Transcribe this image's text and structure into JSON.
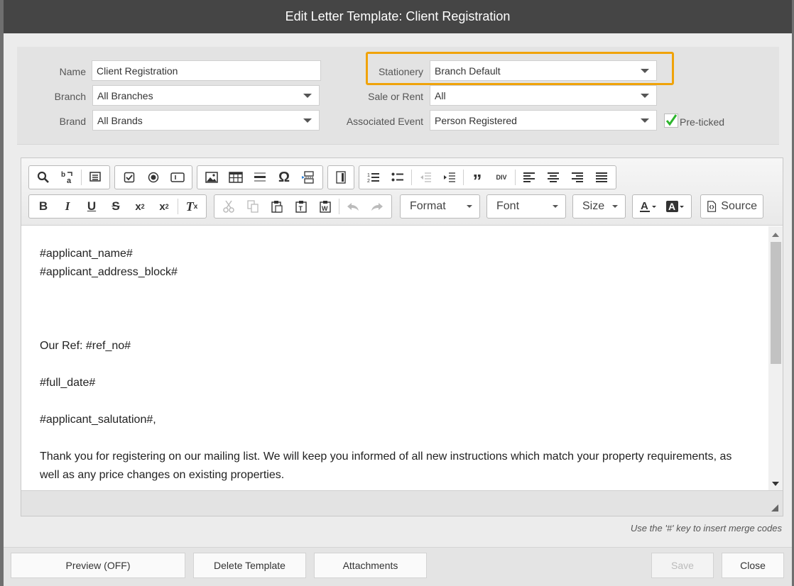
{
  "dialog": {
    "title": "Edit Letter Template: Client Registration"
  },
  "form": {
    "name": {
      "label": "Name",
      "value": "Client Registration"
    },
    "branch": {
      "label": "Branch",
      "value": "All Branches"
    },
    "brand": {
      "label": "Brand",
      "value": "All Brands"
    },
    "stationery": {
      "label": "Stationery",
      "value": "Branch Default"
    },
    "sale_or_rent": {
      "label": "Sale or Rent",
      "value": "All"
    },
    "associated_event": {
      "label": "Associated Event",
      "value": "Person Registered"
    },
    "pre_ticked": {
      "label": "Pre-ticked",
      "checked": true
    }
  },
  "toolbar": {
    "row1_icons": [
      "find-icon",
      "replace-icon",
      "select-all-icon",
      "checkbox-icon",
      "radio-icon",
      "textfield-icon",
      "image-icon",
      "table-icon",
      "horizontal-rule-icon",
      "special-char-icon",
      "page-break-icon",
      "iframe-icon",
      "numbered-list-icon",
      "bulleted-list-icon",
      "outdent-icon",
      "indent-icon",
      "blockquote-icon",
      "div-icon",
      "align-left-icon",
      "align-center-icon",
      "align-right-icon",
      "justify-icon"
    ],
    "row2_icons": [
      "bold-icon",
      "italic-icon",
      "underline-icon",
      "strike-icon",
      "subscript-icon",
      "superscript-icon",
      "remove-format-icon",
      "cut-icon",
      "copy-icon",
      "paste-icon",
      "paste-text-icon",
      "paste-word-icon",
      "undo-icon",
      "redo-icon",
      "text-color-icon",
      "bg-color-icon",
      "source-icon"
    ],
    "format": "Format",
    "font": "Font",
    "size": "Size",
    "source": "Source",
    "div_label": "DIV"
  },
  "content": {
    "line1": "#applicant_name#",
    "line2": "#applicant_address_block#",
    "line3": "Our Ref: #ref_no#",
    "line4": "#full_date#",
    "line5": "#applicant_salutation#,",
    "line6": "Thank you for registering on our mailing list. We will keep you informed of all new instructions which match your property requirements, as",
    "line7": "well as any price changes on existing properties."
  },
  "hint": "Use the '#' key to insert merge codes",
  "footer": {
    "preview": "Preview (OFF)",
    "delete": "Delete Template",
    "attachments": "Attachments",
    "save": "Save",
    "close": "Close"
  },
  "colors": {
    "titlebar": "#454545",
    "highlight": "#f0a30a",
    "check": "#2db52d"
  }
}
